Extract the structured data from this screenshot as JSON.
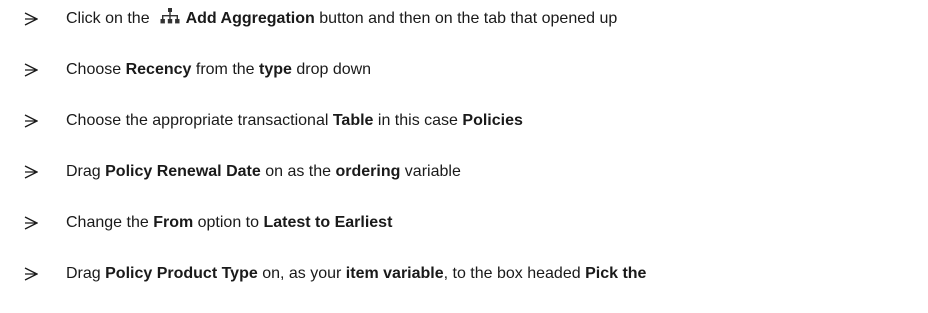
{
  "instructions": [
    {
      "segments": [
        {
          "text": "Click on the",
          "bold": false
        },
        {
          "icon": "add-aggregation-icon"
        },
        {
          "text": "Add Aggregation",
          "bold": true
        },
        {
          "text": " button and then on the tab that opened up",
          "bold": false
        }
      ]
    },
    {
      "segments": [
        {
          "text": "Choose ",
          "bold": false
        },
        {
          "text": "Recency",
          "bold": true
        },
        {
          "text": " from the ",
          "bold": false
        },
        {
          "text": "type",
          "bold": true
        },
        {
          "text": " drop down",
          "bold": false
        }
      ]
    },
    {
      "segments": [
        {
          "text": "Choose the appropriate transactional ",
          "bold": false
        },
        {
          "text": "Table",
          "bold": true
        },
        {
          "text": " in this case ",
          "bold": false
        },
        {
          "text": "Policies",
          "bold": true
        }
      ]
    },
    {
      "segments": [
        {
          "text": "Drag ",
          "bold": false
        },
        {
          "text": "Policy Renewal Date",
          "bold": true
        },
        {
          "text": " on as the ",
          "bold": false
        },
        {
          "text": "ordering",
          "bold": true
        },
        {
          "text": " variable",
          "bold": false
        }
      ]
    },
    {
      "segments": [
        {
          "text": "Change the ",
          "bold": false
        },
        {
          "text": "From",
          "bold": true
        },
        {
          "text": " option to ",
          "bold": false
        },
        {
          "text": "Latest to Earliest",
          "bold": true
        }
      ]
    },
    {
      "segments": [
        {
          "text": "Drag ",
          "bold": false
        },
        {
          "text": "Policy Product Type",
          "bold": true
        },
        {
          "text": " on, as your ",
          "bold": false
        },
        {
          "text": "item variable",
          "bold": true
        },
        {
          "text": ", to the box headed ",
          "bold": false
        },
        {
          "text": "Pick the",
          "bold": true
        }
      ]
    }
  ],
  "bullet_icon": "arrowhead-bullet-icon",
  "colors": {
    "text": "#1a1a1a",
    "icon": "#333333",
    "background": "#ffffff"
  }
}
